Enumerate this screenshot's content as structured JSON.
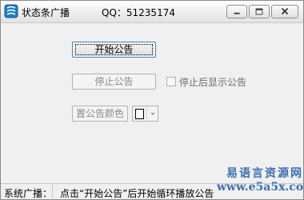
{
  "window": {
    "title": "状态条广播",
    "qq": "QQ：51235174"
  },
  "buttons": {
    "start": "开始公告",
    "stop": "停止公告",
    "color": "置公告颜色"
  },
  "checkbox": {
    "label": "停止后显示公告",
    "checked": false
  },
  "color_picker": {
    "selected_color": "#ffffff"
  },
  "statusbar": {
    "label": "系统广播：",
    "message": "点击“开始公告”后开始循环播放公告"
  },
  "watermark": {
    "top": "易语言资源网",
    "bottom": "www.e5a5x.com"
  },
  "colors": {
    "accent": "#3c7fb1",
    "watermark": "#3a6fb0"
  }
}
